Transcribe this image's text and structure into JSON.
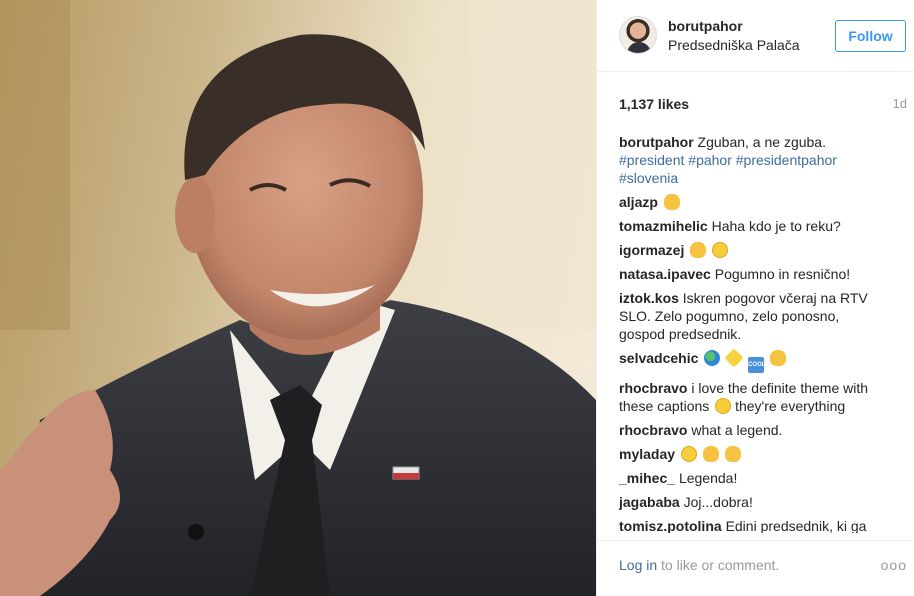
{
  "post": {
    "owner": "borutpahor",
    "location": "Predsedniška Palača",
    "follow_label": "Follow",
    "likes": "1,137 likes",
    "age": "1d",
    "caption": {
      "user": "borutpahor",
      "text": "Zguban, a ne zguba.",
      "hashtags": [
        "#president",
        "#pahor",
        "#presidentpahor",
        "#slovenia"
      ]
    }
  },
  "comments": [
    {
      "user": "aljazp",
      "text": "",
      "emoji": [
        "thumbs-up"
      ]
    },
    {
      "user": "tomazmihelic",
      "text": "Haha kdo je to reku?",
      "emoji": []
    },
    {
      "user": "igormazej",
      "text": "",
      "emoji": [
        "ok-hand",
        "smiling-face-with-halo"
      ]
    },
    {
      "user": "natasa.ipavec",
      "text": "Pogumno in resnično!",
      "emoji": []
    },
    {
      "user": "iztok.kos",
      "text": "Iskren pogovor včeraj na RTV SLO. Zelo pogumno, zelo ponosno, gospod predsednik.",
      "emoji": []
    },
    {
      "user": "selvadcehic",
      "text": "",
      "emoji": [
        "globe",
        "sparkle",
        "cool-button",
        "thumbs-up"
      ]
    },
    {
      "user": "rhocbravo",
      "text": "i love the definite theme with these captions",
      "emoji_mid": "grinning-face-with-sweat",
      "text_after": "they're everything"
    },
    {
      "user": "rhocbravo",
      "text": "what a legend.",
      "emoji": []
    },
    {
      "user": "myladay",
      "text": "",
      "emoji": [
        "grinning-face",
        "clapping-hands",
        "clapping-hands"
      ]
    },
    {
      "user": "_mihec_",
      "text": "Legenda!",
      "emoji": []
    },
    {
      "user": "jagababa",
      "text": "Joj...dobra!",
      "emoji": []
    },
    {
      "user": "tomisz.potolina",
      "text": "Edini predsednik, ki ga",
      "emoji": []
    }
  ],
  "footer": {
    "login_link": "Log in",
    "login_text": "to like or comment.",
    "more": "ooo"
  },
  "colors": {
    "link_blue": "#3d6d9e",
    "follow_blue": "#3897f0",
    "muted": "#999999",
    "divider": "#efefef"
  }
}
